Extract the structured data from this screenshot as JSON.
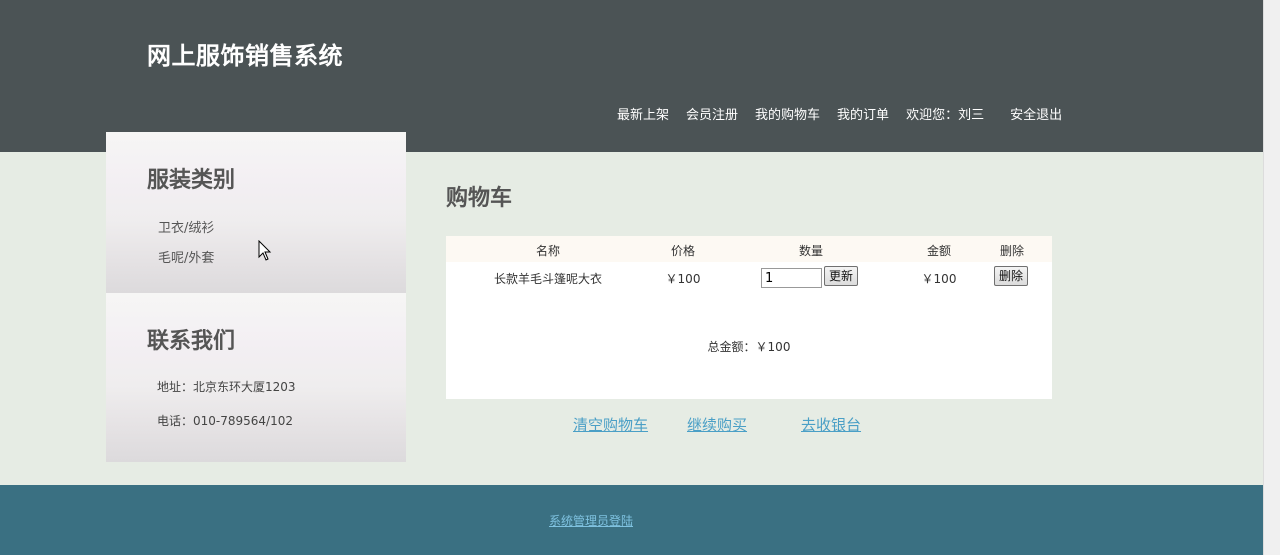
{
  "header": {
    "title": "网上服饰销售系统",
    "nav": [
      "最新上架",
      "会员注册",
      "我的购物车",
      "我的订单",
      "欢迎您：刘三",
      "安全退出"
    ]
  },
  "sidebar": {
    "category_heading": "服装类别",
    "categories": [
      "卫衣/绒衫",
      "毛呢/外套"
    ],
    "contact_heading": "联系我们",
    "address": "地址：北京东环大厦1203",
    "phone": "电话：010-789564/102"
  },
  "cart": {
    "title": "购物车",
    "columns": [
      "名称",
      "价格",
      "数量",
      "金额",
      "删除"
    ],
    "rows": [
      {
        "name": "长款羊毛斗篷呢大衣",
        "price": "￥100",
        "quantity": "1",
        "update_label": "更新",
        "amount": "￥100",
        "delete_label": "删除"
      }
    ],
    "total": "总金额：￥100",
    "actions": [
      "清空购物车",
      "继续购买",
      "去收银台"
    ]
  },
  "footer": {
    "admin_link": "系统管理员登陆"
  },
  "colors": {
    "header_bg": "#4b5355",
    "body_bg": "#e6ece4",
    "footer_bg": "#3a7082",
    "link": "#4a9fc6"
  }
}
